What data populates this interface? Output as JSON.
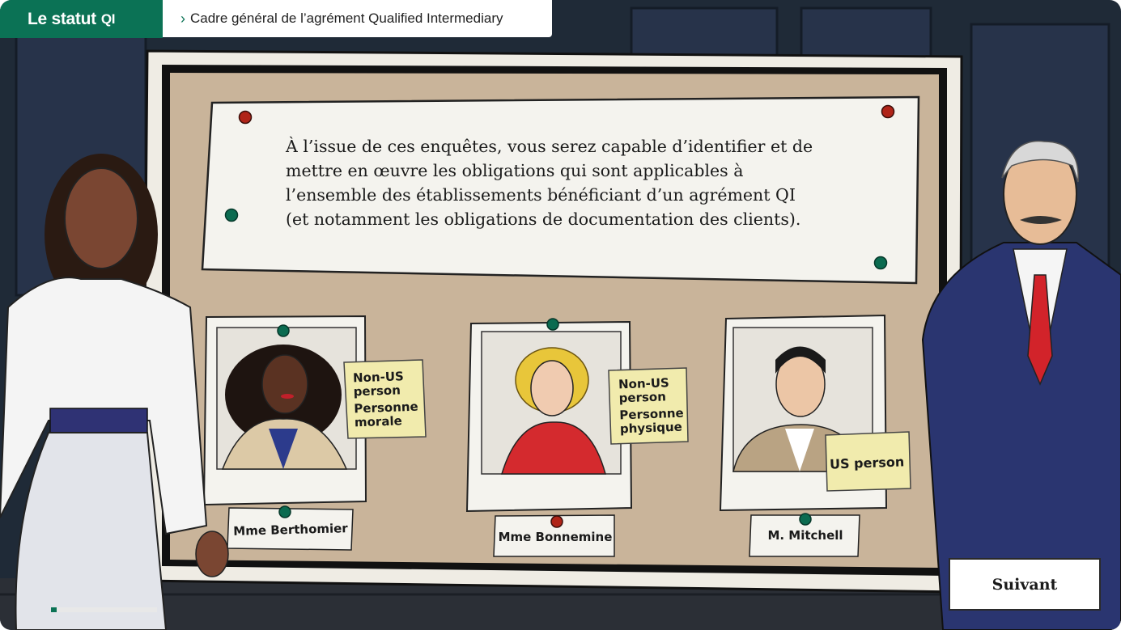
{
  "module": {
    "title": "Le statut",
    "badge": "QI"
  },
  "breadcrumb": {
    "chevron_icon": "chevron-right-icon",
    "label": "Cadre général de l’agrément Qualified Intermediary"
  },
  "intro": {
    "lines": [
      "À l’issue de ces enquêtes, vous serez capable d’identifier et de",
      "mettre en œuvre les obligations qui sont applicables à",
      "l’ensemble des établissements bénéficiant d’un agrément QI",
      "(et notamment les obligations de documentation des clients)."
    ]
  },
  "suspects": [
    {
      "name": "Mme Berthomier",
      "tag_lines": [
        "Non-US",
        "person",
        "Personne",
        "morale"
      ]
    },
    {
      "name": "Mme Bonnemine",
      "tag_lines": [
        "Non-US",
        "person",
        "Personne",
        "physique"
      ]
    },
    {
      "name": "M. Mitchell",
      "tag_lines": [
        "US person"
      ]
    }
  ],
  "next_button": {
    "label": "Suivant"
  },
  "progress": {
    "fraction": 0.05
  },
  "colors": {
    "brand_green": "#0b7255",
    "board": "#c9b49a",
    "pin_red": "#b02418",
    "pin_green": "#0b6b50",
    "sticky": "#f1ebad"
  }
}
